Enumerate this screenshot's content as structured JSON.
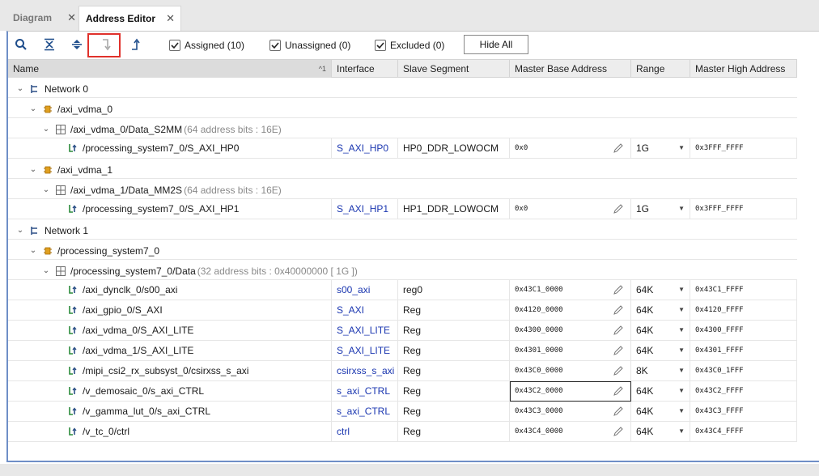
{
  "tabs": [
    {
      "label": "Diagram",
      "active": false
    },
    {
      "label": "Address Editor",
      "active": true
    }
  ],
  "toolbar": {
    "checkboxes": [
      {
        "label": "Assigned (10)",
        "checked": true
      },
      {
        "label": "Unassigned (0)",
        "checked": true
      },
      {
        "label": "Excluded (0)",
        "checked": true
      }
    ],
    "hide_all_label": "Hide All"
  },
  "columns": {
    "name": "Name",
    "sort_indicator": "^1",
    "interface": "Interface",
    "slave_segment": "Slave Segment",
    "master_base_address": "Master Base Address",
    "range": "Range",
    "master_high_address": "Master High Address"
  },
  "rows": [
    {
      "type": "network",
      "level": 0,
      "name": "Network 0",
      "note": ""
    },
    {
      "type": "cell",
      "level": 1,
      "name": "/axi_vdma_0",
      "note": ""
    },
    {
      "type": "space",
      "level": 2,
      "name": "/axi_vdma_0/Data_S2MM",
      "note": "(64 address bits : 16E)"
    },
    {
      "type": "seg",
      "level": 3,
      "name": "/processing_system7_0/S_AXI_HP0",
      "interface": "S_AXI_HP0",
      "slave_segment": "HP0_DDR_LOWOCM",
      "base": "0x0",
      "range": "1G",
      "high": "0x3FFF_FFFF"
    },
    {
      "type": "cell",
      "level": 1,
      "name": "/axi_vdma_1",
      "note": ""
    },
    {
      "type": "space",
      "level": 2,
      "name": "/axi_vdma_1/Data_MM2S",
      "note": "(64 address bits : 16E)"
    },
    {
      "type": "seg",
      "level": 3,
      "name": "/processing_system7_0/S_AXI_HP1",
      "interface": "S_AXI_HP1",
      "slave_segment": "HP1_DDR_LOWOCM",
      "base": "0x0",
      "range": "1G",
      "high": "0x3FFF_FFFF"
    },
    {
      "type": "network",
      "level": 0,
      "name": "Network 1",
      "note": ""
    },
    {
      "type": "cell",
      "level": 1,
      "name": "/processing_system7_0",
      "note": ""
    },
    {
      "type": "space",
      "level": 2,
      "name": "/processing_system7_0/Data",
      "note": "(32 address bits : 0x40000000 [ 1G ])"
    },
    {
      "type": "seg",
      "level": 3,
      "name": "/axi_dynclk_0/s00_axi",
      "interface": "s00_axi",
      "slave_segment": "reg0",
      "base": "0x43C1_0000",
      "range": "64K",
      "high": "0x43C1_FFFF"
    },
    {
      "type": "seg",
      "level": 3,
      "name": "/axi_gpio_0/S_AXI",
      "interface": "S_AXI",
      "slave_segment": "Reg",
      "base": "0x4120_0000",
      "range": "64K",
      "high": "0x4120_FFFF"
    },
    {
      "type": "seg",
      "level": 3,
      "name": "/axi_vdma_0/S_AXI_LITE",
      "interface": "S_AXI_LITE",
      "slave_segment": "Reg",
      "base": "0x4300_0000",
      "range": "64K",
      "high": "0x4300_FFFF"
    },
    {
      "type": "seg",
      "level": 3,
      "name": "/axi_vdma_1/S_AXI_LITE",
      "interface": "S_AXI_LITE",
      "slave_segment": "Reg",
      "base": "0x4301_0000",
      "range": "64K",
      "high": "0x4301_FFFF"
    },
    {
      "type": "seg",
      "level": 3,
      "name": "/mipi_csi2_rx_subsyst_0/csirxss_s_axi",
      "interface": "csirxss_s_axi",
      "slave_segment": "Reg",
      "base": "0x43C0_0000",
      "range": "8K",
      "high": "0x43C0_1FFF"
    },
    {
      "type": "seg",
      "level": 3,
      "name": "/v_demosaic_0/s_axi_CTRL",
      "interface": "s_axi_CTRL",
      "slave_segment": "Reg",
      "base": "0x43C2_0000",
      "range": "64K",
      "high": "0x43C2_FFFF",
      "selected": true
    },
    {
      "type": "seg",
      "level": 3,
      "name": "/v_gamma_lut_0/s_axi_CTRL",
      "interface": "s_axi_CTRL",
      "slave_segment": "Reg",
      "base": "0x43C3_0000",
      "range": "64K",
      "high": "0x43C3_FFFF"
    },
    {
      "type": "seg",
      "level": 3,
      "name": "/v_tc_0/ctrl",
      "interface": "ctrl",
      "slave_segment": "Reg",
      "base": "0x43C4_0000",
      "range": "64K",
      "high": "0x43C4_FFFF"
    }
  ],
  "icons": {
    "network": "network-icon",
    "cell": "ip-cell-icon",
    "space": "address-space-icon",
    "seg": "address-segment-icon"
  },
  "colors": {
    "interface_text": "#1a36b0",
    "highlight_box": "#e0312b",
    "panel_border": "#6f8fc7"
  }
}
